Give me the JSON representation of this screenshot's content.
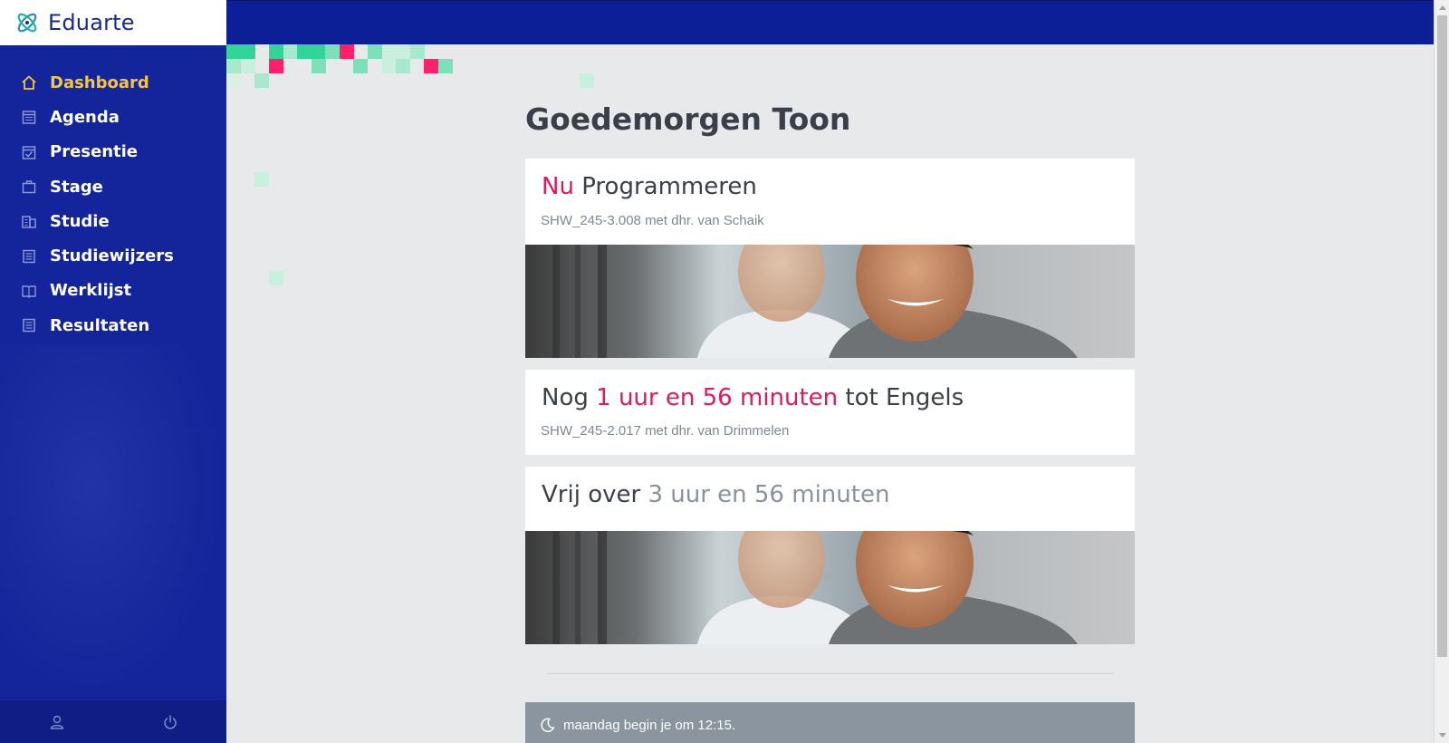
{
  "app": {
    "name": "Eduarte"
  },
  "sidebar": {
    "items": [
      {
        "label": "Dashboard",
        "icon": "home-icon",
        "active": true
      },
      {
        "label": "Agenda",
        "icon": "calendar-icon",
        "active": false
      },
      {
        "label": "Presentie",
        "icon": "calendar-check-icon",
        "active": false
      },
      {
        "label": "Stage",
        "icon": "briefcase-icon",
        "active": false
      },
      {
        "label": "Studie",
        "icon": "building-icon",
        "active": false
      },
      {
        "label": "Studiewijzers",
        "icon": "list-icon",
        "active": false
      },
      {
        "label": "Werklijst",
        "icon": "book-icon",
        "active": false
      },
      {
        "label": "Resultaten",
        "icon": "list-icon",
        "active": false
      }
    ],
    "footer": {
      "profile_icon": "user-icon",
      "logout_icon": "power-icon"
    }
  },
  "main": {
    "greeting": "Goedemorgen Toon",
    "now_card": {
      "prefix": "Nu",
      "subject": "Programmeren",
      "location": "SHW_245-3.008 met dhr. van Schaik"
    },
    "next_card": {
      "prefix": "Nog",
      "countdown": "1 uur en 56 minuten",
      "suffix": "tot Engels",
      "location": "SHW_245-2.017 met dhr. van Drimmelen"
    },
    "free_card": {
      "prefix": "Vrij over",
      "duration": "3 uur en 56 minuten"
    },
    "notice": {
      "icon": "moon-icon",
      "text": "maandag begin je om 12:15."
    }
  },
  "colors": {
    "sidebar": "#14249a",
    "topbar": "#0d1f97",
    "active_nav": "#f5c542",
    "accent": "#e0195a",
    "pixel_green": "#34d399",
    "pixel_pink": "#ff1f6b"
  }
}
